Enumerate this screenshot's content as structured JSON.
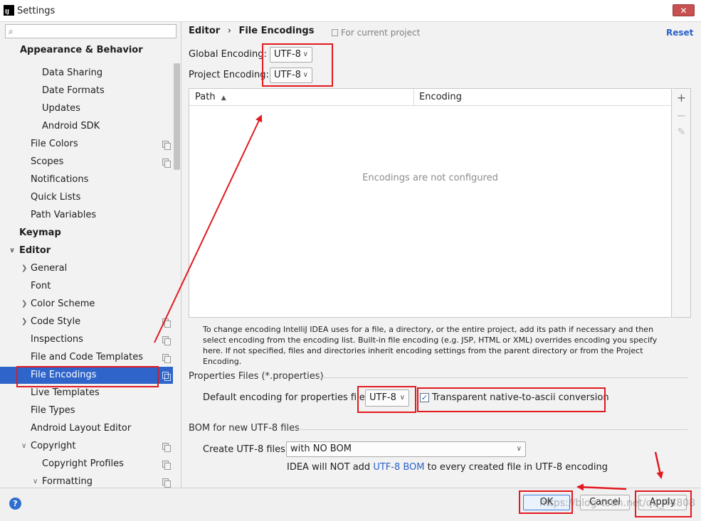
{
  "window": {
    "title": "Settings",
    "app_icon_text": "IJ",
    "close_label": "✕"
  },
  "sidebar": {
    "search_placeholder": "",
    "items": [
      {
        "label": "Appearance & Behavior",
        "bold": true
      },
      {
        "label": "Data Sharing"
      },
      {
        "label": "Date Formats"
      },
      {
        "label": "Updates"
      },
      {
        "label": "Android SDK"
      },
      {
        "label": "File Colors"
      },
      {
        "label": "Scopes"
      },
      {
        "label": "Notifications"
      },
      {
        "label": "Quick Lists"
      },
      {
        "label": "Path Variables"
      },
      {
        "label": "Keymap",
        "bold": true
      },
      {
        "label": "Editor",
        "bold": true
      },
      {
        "label": "General"
      },
      {
        "label": "Font"
      },
      {
        "label": "Color Scheme"
      },
      {
        "label": "Code Style"
      },
      {
        "label": "Inspections"
      },
      {
        "label": "File and Code Templates"
      },
      {
        "label": "File Encodings",
        "selected": true
      },
      {
        "label": "Live Templates"
      },
      {
        "label": "File Types"
      },
      {
        "label": "Android Layout Editor"
      },
      {
        "label": "Copyright"
      },
      {
        "label": "Copyright Profiles"
      },
      {
        "label": "Formatting"
      }
    ]
  },
  "header": {
    "breadcrumb_parent": "Editor",
    "breadcrumb_sep": "›",
    "breadcrumb_current": "File Encodings",
    "for_project": "For current project",
    "reset": "Reset"
  },
  "encoding": {
    "global_label": "Global Encoding:",
    "global_value": "UTF-8",
    "project_label": "Project Encoding:",
    "project_value": "UTF-8"
  },
  "table": {
    "col_path": "Path",
    "col_path_sort": "▲",
    "col_encoding": "Encoding",
    "empty": "Encodings are not configured",
    "add": "+",
    "remove": "−",
    "edit": "✎"
  },
  "description": "To change encoding IntelliJ IDEA uses for a file, a directory, or the entire project, add its path if necessary and then select encoding from the encoding list. Built-in file encoding (e.g. JSP, HTML or XML) overrides encoding you specify here. If not specified, files and directories inherit encoding settings from the parent directory or from the Project Encoding.",
  "properties": {
    "section": "Properties Files (*.properties)",
    "default_label": "Default encoding for properties files:",
    "default_value": "UTF-8",
    "transparent_label": "Transparent native-to-ascii conversion",
    "transparent_checked": "✓"
  },
  "bom": {
    "section": "BOM for new UTF-8 files",
    "create_label": "Create UTF-8 files:",
    "create_value": "with NO BOM",
    "note_prefix": "IDEA will NOT add",
    "note_link": "UTF-8 BOM",
    "note_suffix": "to every created file in UTF-8 encoding"
  },
  "buttons": {
    "help": "?",
    "ok": "OK",
    "cancel": "Cancel",
    "apply": "Apply"
  },
  "watermark": "https://blog.csdn.net/qq_44808",
  "colors": {
    "selection": "#2f65ca",
    "link": "#2a62c9",
    "annotation": "#e2191f"
  }
}
